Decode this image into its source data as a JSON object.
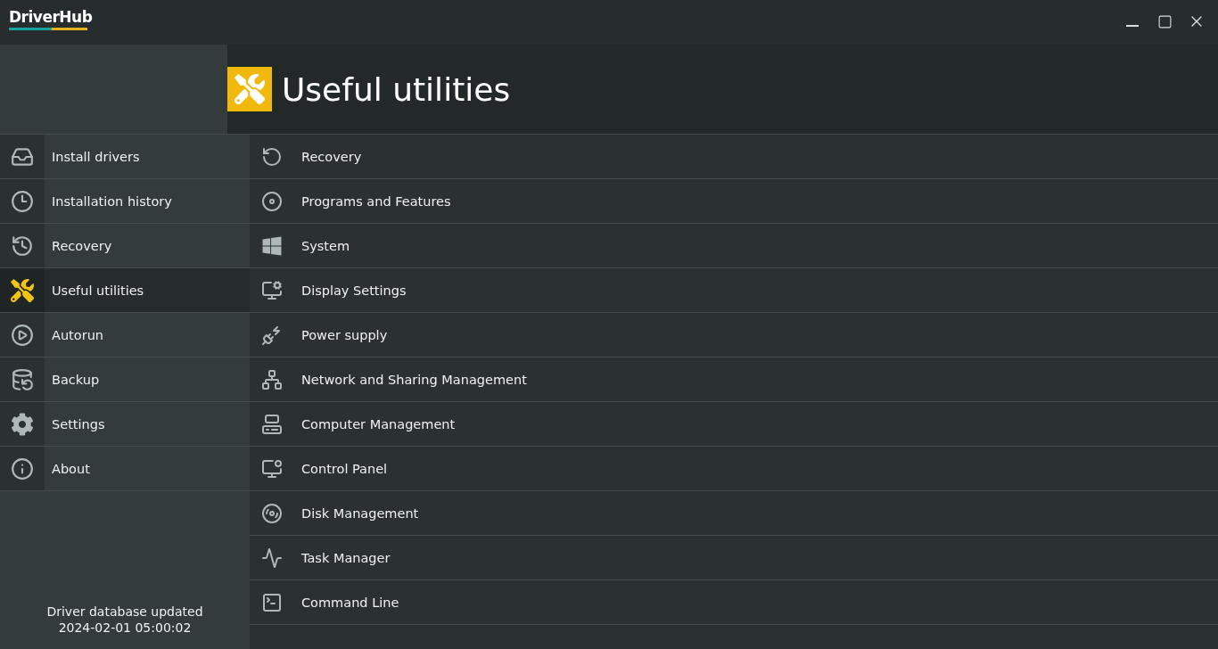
{
  "window": {
    "title": "DriverHub"
  },
  "page": {
    "title": "Useful utilities"
  },
  "sidebar": {
    "items": [
      {
        "label": "Install drivers",
        "selected": false
      },
      {
        "label": "Installation history",
        "selected": false
      },
      {
        "label": "Recovery",
        "selected": false
      },
      {
        "label": "Useful utilities",
        "selected": true
      },
      {
        "label": "Autorun",
        "selected": false
      },
      {
        "label": "Backup",
        "selected": false
      },
      {
        "label": "Settings",
        "selected": false
      },
      {
        "label": "About",
        "selected": false
      }
    ],
    "footer": [
      "Driver database updated",
      "2024-02-01 05:00:02"
    ]
  },
  "utilities": [
    {
      "label": "Recovery"
    },
    {
      "label": "Programs and Features"
    },
    {
      "label": "System"
    },
    {
      "label": "Display Settings"
    },
    {
      "label": "Power supply"
    },
    {
      "label": "Network and Sharing Management"
    },
    {
      "label": "Computer Management"
    },
    {
      "label": "Control Panel"
    },
    {
      "label": "Disk Management"
    },
    {
      "label": "Task Manager"
    },
    {
      "label": "Command Line"
    }
  ]
}
